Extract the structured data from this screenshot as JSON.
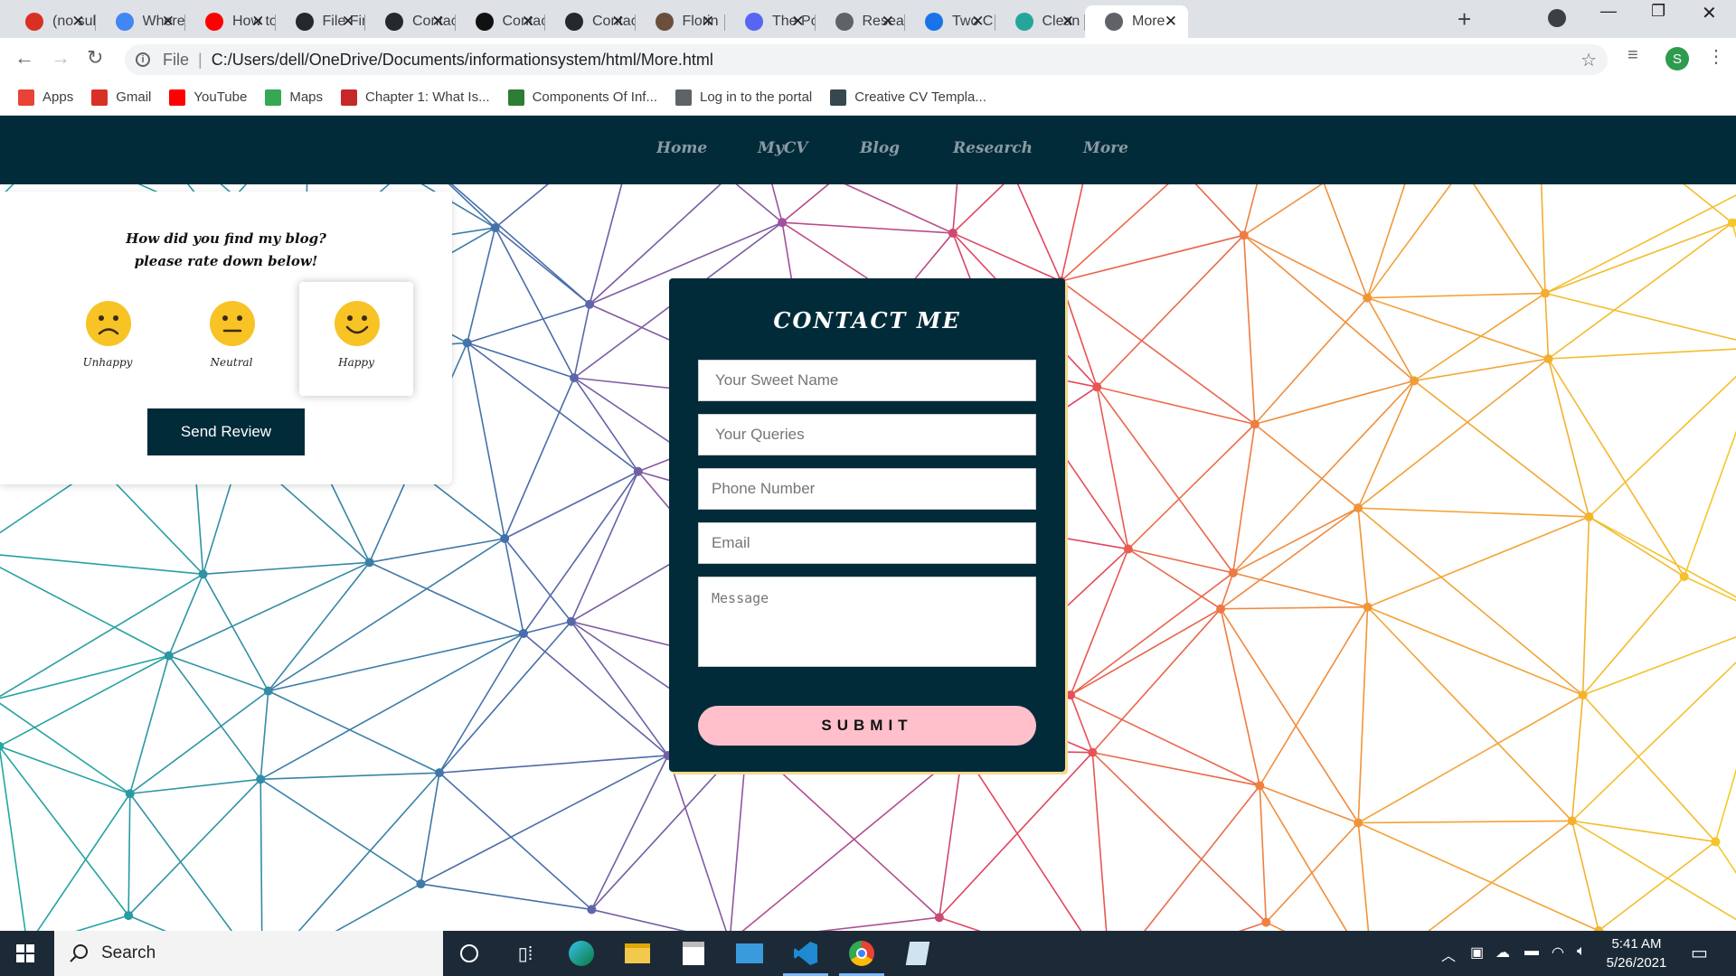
{
  "browser": {
    "tabs": [
      {
        "title": "(no subject)",
        "icon": "gmail-icon",
        "color": "#d93025"
      },
      {
        "title": "Where",
        "icon": "google-icon",
        "color": "#4285f4"
      },
      {
        "title": "How to",
        "icon": "youtube-icon",
        "color": "#ff0000"
      },
      {
        "title": "File Finder",
        "icon": "github-icon",
        "color": "#24292e"
      },
      {
        "title": "Contact",
        "icon": "github-icon",
        "color": "#24292e"
      },
      {
        "title": "Contact",
        "icon": "codepen-icon",
        "color": "#111111"
      },
      {
        "title": "Contact",
        "icon": "github-icon",
        "color": "#24292e"
      },
      {
        "title": "Florin",
        "icon": "profile-photo-icon",
        "color": "#6b4f3a"
      },
      {
        "title": "The Pc",
        "icon": "discord-icon",
        "color": "#5865f2"
      },
      {
        "title": "Research",
        "icon": "globe-icon",
        "color": "#5f6368"
      },
      {
        "title": "Two C",
        "icon": "bookmark-icon",
        "color": "#1a73e8"
      },
      {
        "title": "Clean",
        "icon": "diamond-icon",
        "color": "#26a69a"
      },
      {
        "title": "More",
        "icon": "globe-icon",
        "color": "#5f6368"
      }
    ],
    "address": {
      "scheme": "File",
      "url": "C:/Users/dell/OneDrive/Documents/informationsystem/html/More.html"
    },
    "profile_initial": "S",
    "bookmarks": [
      {
        "label": "Apps",
        "icon": "apps-grid-icon",
        "color": "#ea4335"
      },
      {
        "label": "Gmail",
        "icon": "gmail-icon",
        "color": "#d93025"
      },
      {
        "label": "YouTube",
        "icon": "youtube-icon",
        "color": "#ff0000"
      },
      {
        "label": "Maps",
        "icon": "maps-icon",
        "color": "#34a853"
      },
      {
        "label": "Chapter 1: What Is...",
        "icon": "pb-icon",
        "color": "#c62828"
      },
      {
        "label": "Components Of Inf...",
        "icon": "link-icon",
        "color": "#2e7d32"
      },
      {
        "label": "Log in to the portal",
        "icon": "globe-icon",
        "color": "#5f6368"
      },
      {
        "label": "Creative CV Templa...",
        "icon": "cv-icon",
        "color": "#37474f"
      }
    ]
  },
  "site": {
    "nav": [
      "Home",
      "MyCV",
      "Blog",
      "Research",
      "More"
    ],
    "review": {
      "question_line1": "How did you find my blog?",
      "question_line2": "please rate down below!",
      "options": [
        {
          "label": "Unhappy",
          "mood": "sad-face-icon"
        },
        {
          "label": "Neutral",
          "mood": "neutral-face-icon"
        },
        {
          "label": "Happy",
          "mood": "happy-face-icon",
          "selected": true
        }
      ],
      "send_label": "Send Review"
    },
    "contact": {
      "title": "CONTACT ME",
      "placeholders": {
        "name": "Your Sweet Name",
        "queries": "Your Queries",
        "phone": "Phone Number",
        "email": "Email",
        "message": "Message"
      },
      "submit_label": "SUBMIT"
    }
  },
  "taskbar": {
    "search_placeholder": "Search",
    "time": "5:41 AM",
    "date": "5/26/2021",
    "pinned": [
      "cortana-circle-icon",
      "task-view-icon",
      "edge-icon",
      "file-explorer-icon",
      "store-icon",
      "mail-icon",
      "vscode-icon",
      "chrome-icon",
      "notepad-icon"
    ]
  }
}
